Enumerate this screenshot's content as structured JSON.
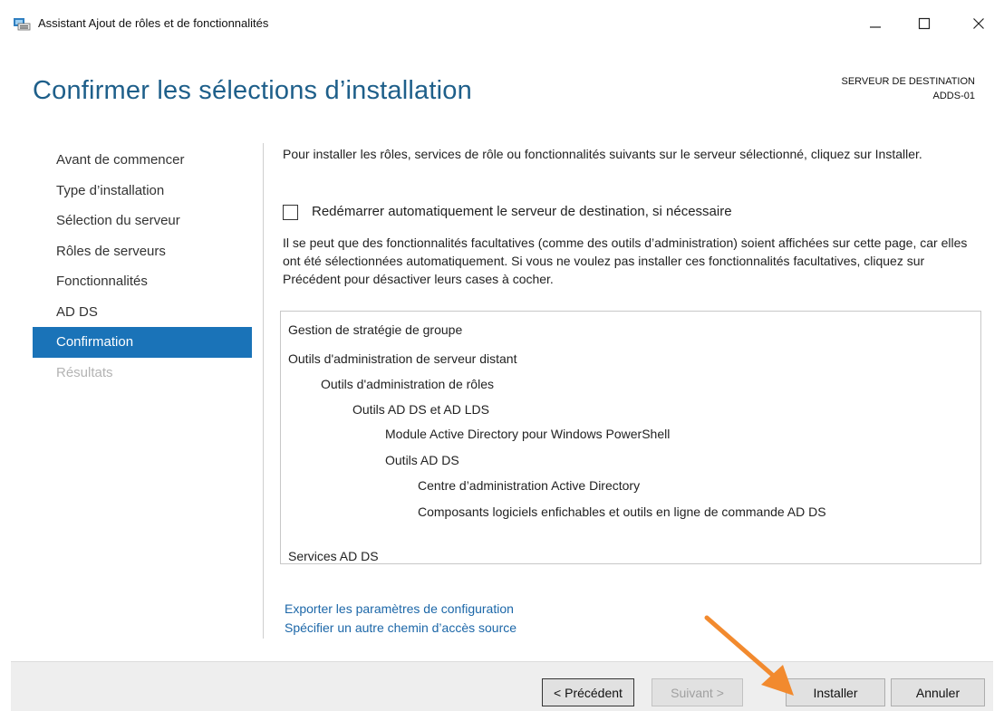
{
  "window": {
    "title": "Assistant Ajout de rôles et de fonctionnalités",
    "controls": {
      "minimize": "—",
      "maximize": "☐",
      "close": "✕"
    }
  },
  "header": {
    "page_title": "Confirmer les sélections d’installation",
    "destination_label": "SERVEUR DE DESTINATION",
    "destination_server": "ADDS-01"
  },
  "nav": {
    "items": [
      {
        "label": "Avant de commencer",
        "state": "normal"
      },
      {
        "label": "Type d’installation",
        "state": "normal"
      },
      {
        "label": "Sélection du serveur",
        "state": "normal"
      },
      {
        "label": "Rôles de serveurs",
        "state": "normal"
      },
      {
        "label": "Fonctionnalités",
        "state": "normal"
      },
      {
        "label": "AD DS",
        "state": "normal"
      },
      {
        "label": "Confirmation",
        "state": "active"
      },
      {
        "label": "Résultats",
        "state": "disabled"
      }
    ]
  },
  "main": {
    "intro": "Pour installer les rôles, services de rôle ou fonctionnalités suivants sur le serveur sélectionné, cliquez sur Installer.",
    "restart_checkbox": {
      "label": "Redémarrer automatiquement le serveur de destination, si nécessaire",
      "checked": false
    },
    "note": "Il se peut que des fonctionnalités facultatives (comme des outils d’administration) soient affichées sur cette page, car elles ont été sélectionnées automatiquement. Si vous ne voulez pas installer ces fonctionnalités facultatives, cliquez sur Précédent pour désactiver leurs cases à cocher.",
    "selections": [
      {
        "text": "Gestion de stratégie de groupe",
        "level": 0
      },
      {
        "text": "Outils d'administration de serveur distant",
        "level": 0
      },
      {
        "text": "Outils d'administration de rôles",
        "level": 1
      },
      {
        "text": "Outils AD DS et AD LDS",
        "level": 2
      },
      {
        "text": "Module Active Directory pour Windows PowerShell",
        "level": 3
      },
      {
        "text": "Outils AD DS",
        "level": 3
      },
      {
        "text": "Centre d’administration Active Directory",
        "level": 4
      },
      {
        "text": "Composants logiciels enfichables et outils en ligne de commande AD DS",
        "level": 4
      },
      {
        "text": "Services AD DS",
        "level": 0
      }
    ],
    "links": {
      "export": "Exporter les paramètres de configuration",
      "alt_source": "Spécifier un autre chemin d’accès source"
    }
  },
  "footer": {
    "prev": "< Précédent",
    "next": "Suivant >",
    "install": "Installer",
    "cancel": "Annuler"
  },
  "colors": {
    "title_blue": "#1e5f8a",
    "nav_active": "#1a73b8",
    "link_blue": "#1c67a8",
    "arrow_orange": "#f28a2e"
  },
  "icons": {
    "app": "server-manager-icon",
    "annotation": "orange-arrow-icon"
  }
}
